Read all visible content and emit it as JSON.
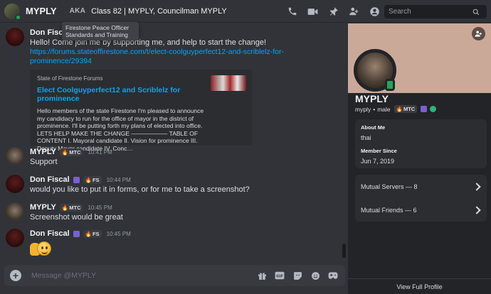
{
  "header": {
    "username": "MYPLY",
    "aka_label": "AKA",
    "nicknames": "Class 82 | MYPLY, Councilman MYPLY",
    "search_placeholder": "Search",
    "icons": [
      "phone-icon",
      "video-icon",
      "pin-icon",
      "add-friend-icon",
      "profile-icon"
    ]
  },
  "tooltip": {
    "text": "Firestone Peace Officer Standards and Training"
  },
  "messages": [
    {
      "author": "Don Fiscal",
      "text": "Hello! Come join me by supporting me, and help to start the change!",
      "link": "https://forums.stateoffirestone.com/t/elect-coolguyperfect12-and-scriblelz-for-prominence/29394",
      "embed": {
        "site": "State of Firestone Forums",
        "title": "Elect Coolguyperfect12 and Scriblelz for prominence",
        "description": "Hello members of the state Firestone I'm pleased to announce my candidacy to run for the office of mayor in the district of prominence. I'll be putting forth my plans of elected into office. LETS HELP MAKE THE CHANGE —————— TABLE OF CONTENT I. Mayoral candidate II. Vision for prominence III. Deputy Mayor candidate IV. Conc…"
      }
    },
    {
      "author": "MYPLY",
      "tag": "MTC",
      "time": "10:41 PM",
      "text": "Support"
    },
    {
      "author": "Don Fiscal",
      "tag": "FS",
      "time": "10:44 PM",
      "text": "would you like to put it in forms, or for me to take a screenshot?"
    },
    {
      "author": "MYPLY",
      "tag": "MTC",
      "time": "10:45 PM",
      "text": "Screenshot would be great"
    },
    {
      "author": "Don Fiscal",
      "tag": "FS",
      "time": "10:45 PM"
    }
  ],
  "composer": {
    "placeholder": "Message @MYPLY",
    "icons": [
      "gift-icon",
      "gif-icon",
      "sticker-icon",
      "emoji-icon",
      "activity-icon"
    ]
  },
  "profile": {
    "display_name": "MYPLY",
    "username": "myply",
    "separator": "•",
    "pronoun": "male",
    "tag": "MTC",
    "about_label": "About Me",
    "about_text": "thai",
    "member_since_label": "Member Since",
    "member_since": "Jun 7, 2019",
    "mutual_servers": "Mutual Servers — 8",
    "mutual_friends": "Mutual Friends — 6",
    "view_full": "View Full Profile"
  },
  "colors": {
    "background": "#313338",
    "panel": "#232428",
    "banner": "#cba999",
    "link": "#00a8fc",
    "online": "#23a55a"
  }
}
